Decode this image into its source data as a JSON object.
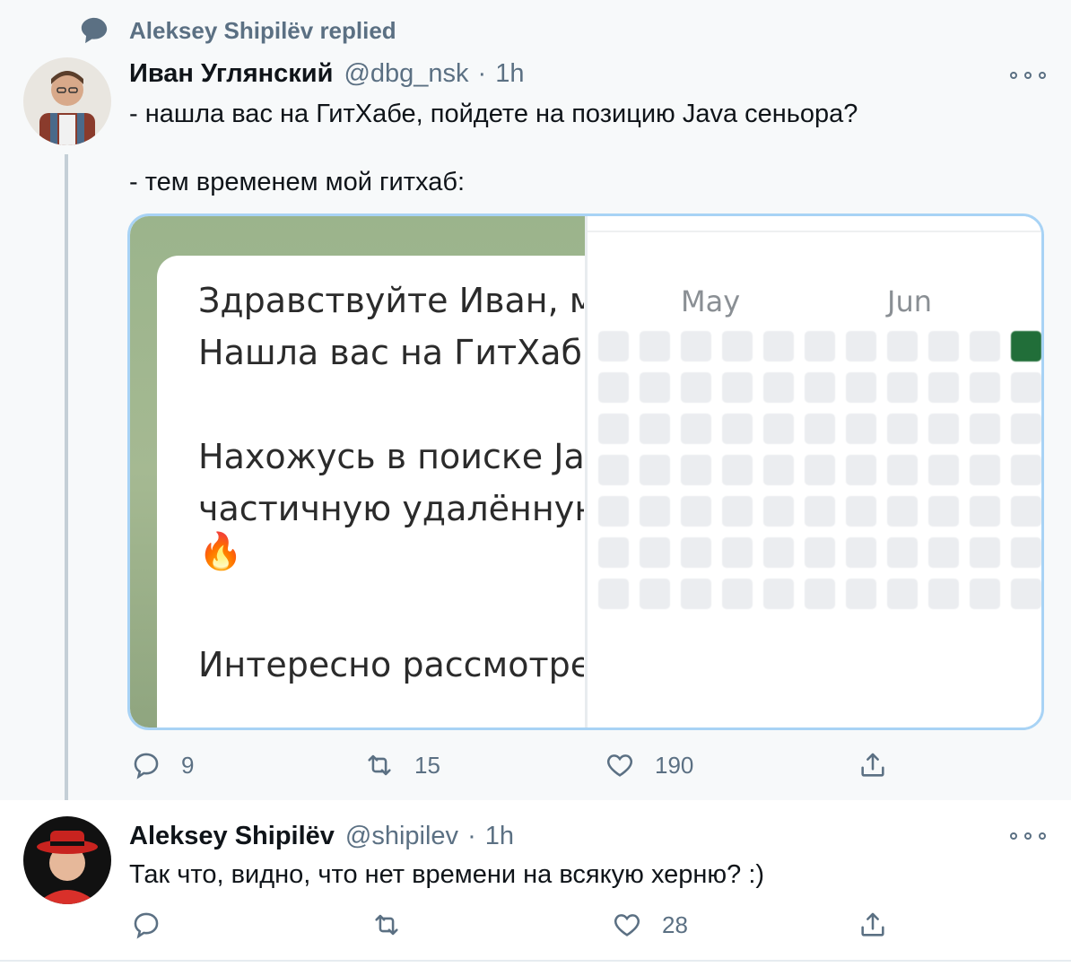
{
  "context": {
    "text": "Aleksey Shipilёv replied"
  },
  "parent_tweet": {
    "display_name": "Иван Углянский",
    "handle": "@dbg_nsk",
    "separator": "·",
    "time": "1h",
    "text": "- нашла вас на ГитХабе, пойдете на позицию Java сеньора?\n\n- тем временем мой гитхаб:",
    "media": {
      "chat_lines": [
        "Здравствуйте Иван, м",
        "Нашла вас на ГитХабе",
        "Нахожусь в поиске Jav",
        "частичную удалённую",
        "Интересно рассмотре"
      ],
      "emoji": "🔥",
      "months": [
        "May",
        "Jun"
      ]
    },
    "actions": {
      "replies": "9",
      "retweets": "15",
      "likes": "190"
    }
  },
  "reply_tweet": {
    "display_name": "Aleksey Shipilёv",
    "handle": "@shipilev",
    "separator": "·",
    "time": "1h",
    "text": "Так что, видно, что нет времени на всякую херню? :)",
    "actions": {
      "replies": "",
      "retweets": "",
      "likes": "28"
    }
  },
  "colors": {
    "accent_border": "#a8d3f5",
    "muted": "#5b7083",
    "contribution_active": "#216e39",
    "contribution_empty": "#ebedf0"
  }
}
